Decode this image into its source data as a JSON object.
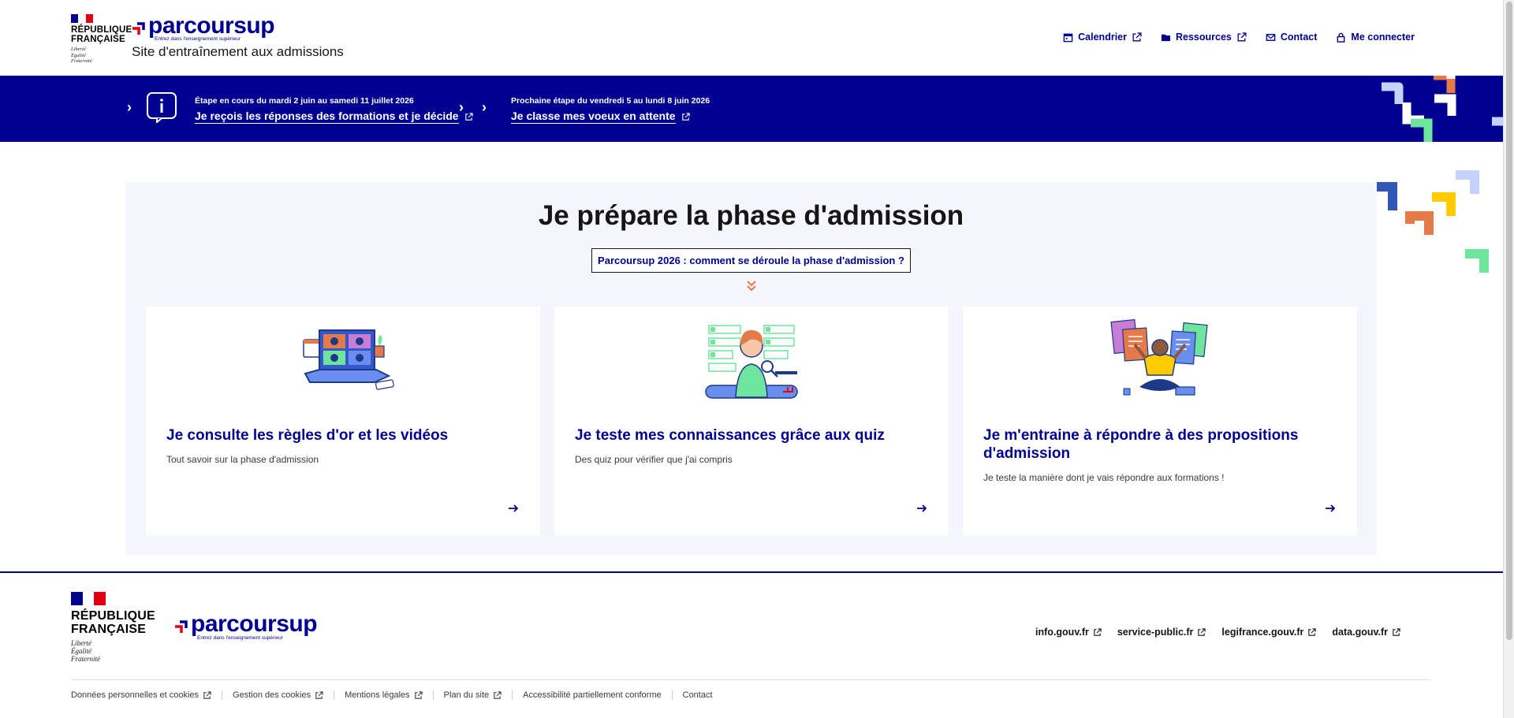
{
  "header": {
    "republic": [
      "République",
      "Française"
    ],
    "devise": [
      "Liberté",
      "Égalité",
      "Fraternité"
    ],
    "logo_word": "parcoursup",
    "logo_tagline": "Entrez dans l'enseignement supérieur",
    "site_title": "Site d'entraînement aux admissions",
    "nav": [
      {
        "label": "Calendrier",
        "icon": "calendar-icon",
        "external": true
      },
      {
        "label": "Ressources",
        "icon": "folder-icon",
        "external": true
      },
      {
        "label": "Contact",
        "icon": "mail-icon",
        "external": false
      },
      {
        "label": "Me connecter",
        "icon": "lock-icon",
        "external": false
      }
    ]
  },
  "banner": {
    "current_step_date": "Étape en cours du mardi 2 juin au samedi 11 juillet 2026",
    "current_step_link": "Je reçois les réponses des formations et je décide",
    "next_step_date": "Prochaine étape du vendredi 5 au lundi 8 juin 2026",
    "next_step_link": "Je classe mes voeux en attente"
  },
  "main": {
    "title": "Je prépare la phase d'admission",
    "phase_button": "Parcoursup 2026 : comment se déroule la phase d'admission ?",
    "cards": [
      {
        "title": "Je consulte les règles d'or et les vidéos",
        "text": "Tout savoir sur la phase d'admission"
      },
      {
        "title": "Je teste mes connaissances grâce aux quiz",
        "text": "Des quiz pour vérifier que j'ai compris"
      },
      {
        "title": "Je m'entraine à répondre à des propositions d'admission",
        "text": "Je teste la manière dont je vais répondre aux formations !"
      }
    ]
  },
  "footer": {
    "external_links": [
      "info.gouv.fr",
      "service-public.fr",
      "legifrance.gouv.fr",
      "data.gouv.fr"
    ],
    "bottom_links": [
      {
        "label": "Données personnelles et cookies",
        "external": true
      },
      {
        "label": "Gestion des cookies",
        "external": true
      },
      {
        "label": "Mentions légales",
        "external": true
      },
      {
        "label": "Plan du site",
        "external": true
      },
      {
        "label": "Accessibilité partiellement conforme",
        "external": false
      },
      {
        "label": "Contact",
        "external": false
      }
    ]
  },
  "colors": {
    "primary": "#000091",
    "panel_bg": "#f5f5fe",
    "accent_orange": "#e4794a",
    "accent_green": "#6fe49d",
    "accent_lavender": "#c5d1ff",
    "accent_yellow": "#ffca00"
  }
}
